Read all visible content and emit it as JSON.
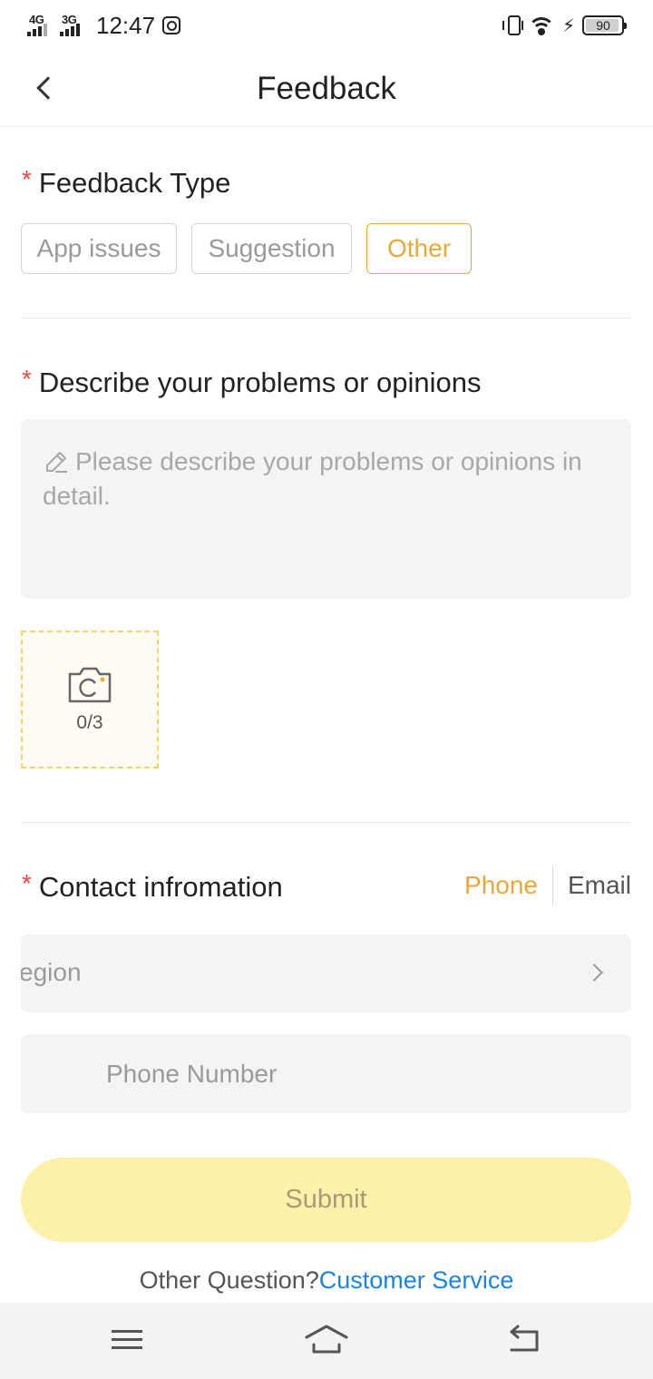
{
  "status_bar": {
    "network1": "4G",
    "network2": "3G",
    "time": "12:47",
    "battery": "90"
  },
  "header": {
    "title": "Feedback"
  },
  "feedback_type": {
    "required_mark": "*",
    "title": "Feedback Type",
    "options": [
      "App issues",
      "Suggestion",
      "Other"
    ],
    "selected": "Other"
  },
  "describe": {
    "required_mark": "*",
    "title": "Describe your problems or opinions",
    "placeholder": "Please describe your problems or opinions in detail."
  },
  "upload": {
    "count": "0/3"
  },
  "contact": {
    "required_mark": "*",
    "title": "Contact infromation",
    "toggle_phone": "Phone",
    "toggle_email": "Email",
    "region_text": "egion",
    "phone_placeholder": "Phone Number"
  },
  "submit_label": "Submit",
  "footer": {
    "question": "Other Question?",
    "link": "Customer Service"
  },
  "colors": {
    "accent": "#e9a93a",
    "required": "#f04b3e",
    "submit_bg": "#fdf0a8",
    "link": "#1b84e0"
  }
}
